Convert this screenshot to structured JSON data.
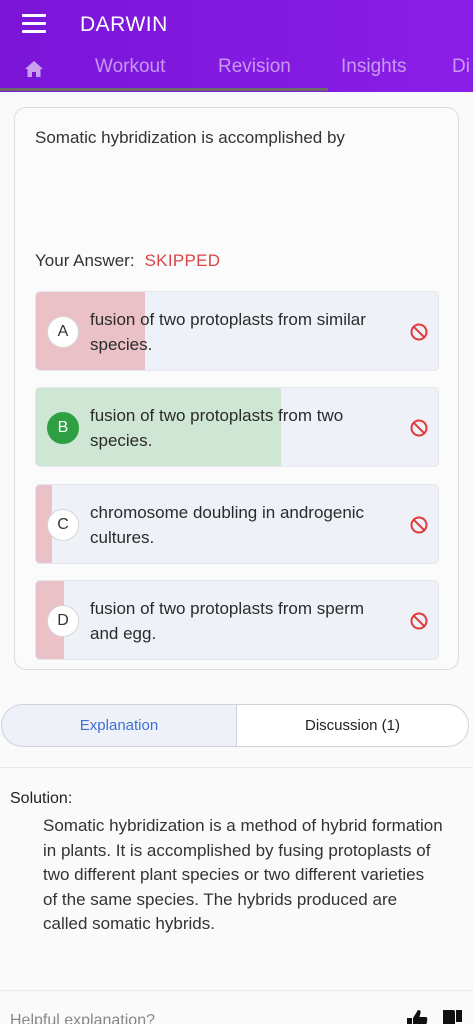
{
  "header": {
    "title": "DARWIN",
    "tabs": [
      "Workout",
      "Revision",
      "Insights",
      "Di"
    ]
  },
  "question": {
    "text": "Somatic hybridization is accomplished by",
    "answer_label": "Your Answer:",
    "answer_status": "SKIPPED"
  },
  "options": [
    {
      "letter": "A",
      "text": "fusion of two protoplasts from similar species.",
      "percent": 27,
      "status": "incorrect"
    },
    {
      "letter": "B",
      "text": "fusion of two protoplasts from two species.",
      "percent": 61,
      "status": "correct"
    },
    {
      "letter": "C",
      "text": "chromosome doubling in androgenic cultures.",
      "percent": 4,
      "status": "incorrect"
    },
    {
      "letter": "D",
      "text": "fusion of two protoplasts from sperm and egg.",
      "percent": 7,
      "status": "incorrect"
    }
  ],
  "tabs_bottom": {
    "explanation": "Explanation",
    "discussion": "Discussion (1)"
  },
  "solution": {
    "label": "Solution:",
    "text": "Somatic hybridization is a method of hybrid formation in plants. It is accomplished by fusing protoplasts of two different plant species or two different varieties of the same species. The hybrids produced are called somatic hybrids."
  },
  "feedback": {
    "prompt": "Helpful explanation?"
  },
  "colors": {
    "appbar": "#7a15d8",
    "correct_fill": "#cfe6d4",
    "incorrect_fill": "#e9c1c7",
    "skipped": "#d94545",
    "link": "#3f6fd8"
  }
}
